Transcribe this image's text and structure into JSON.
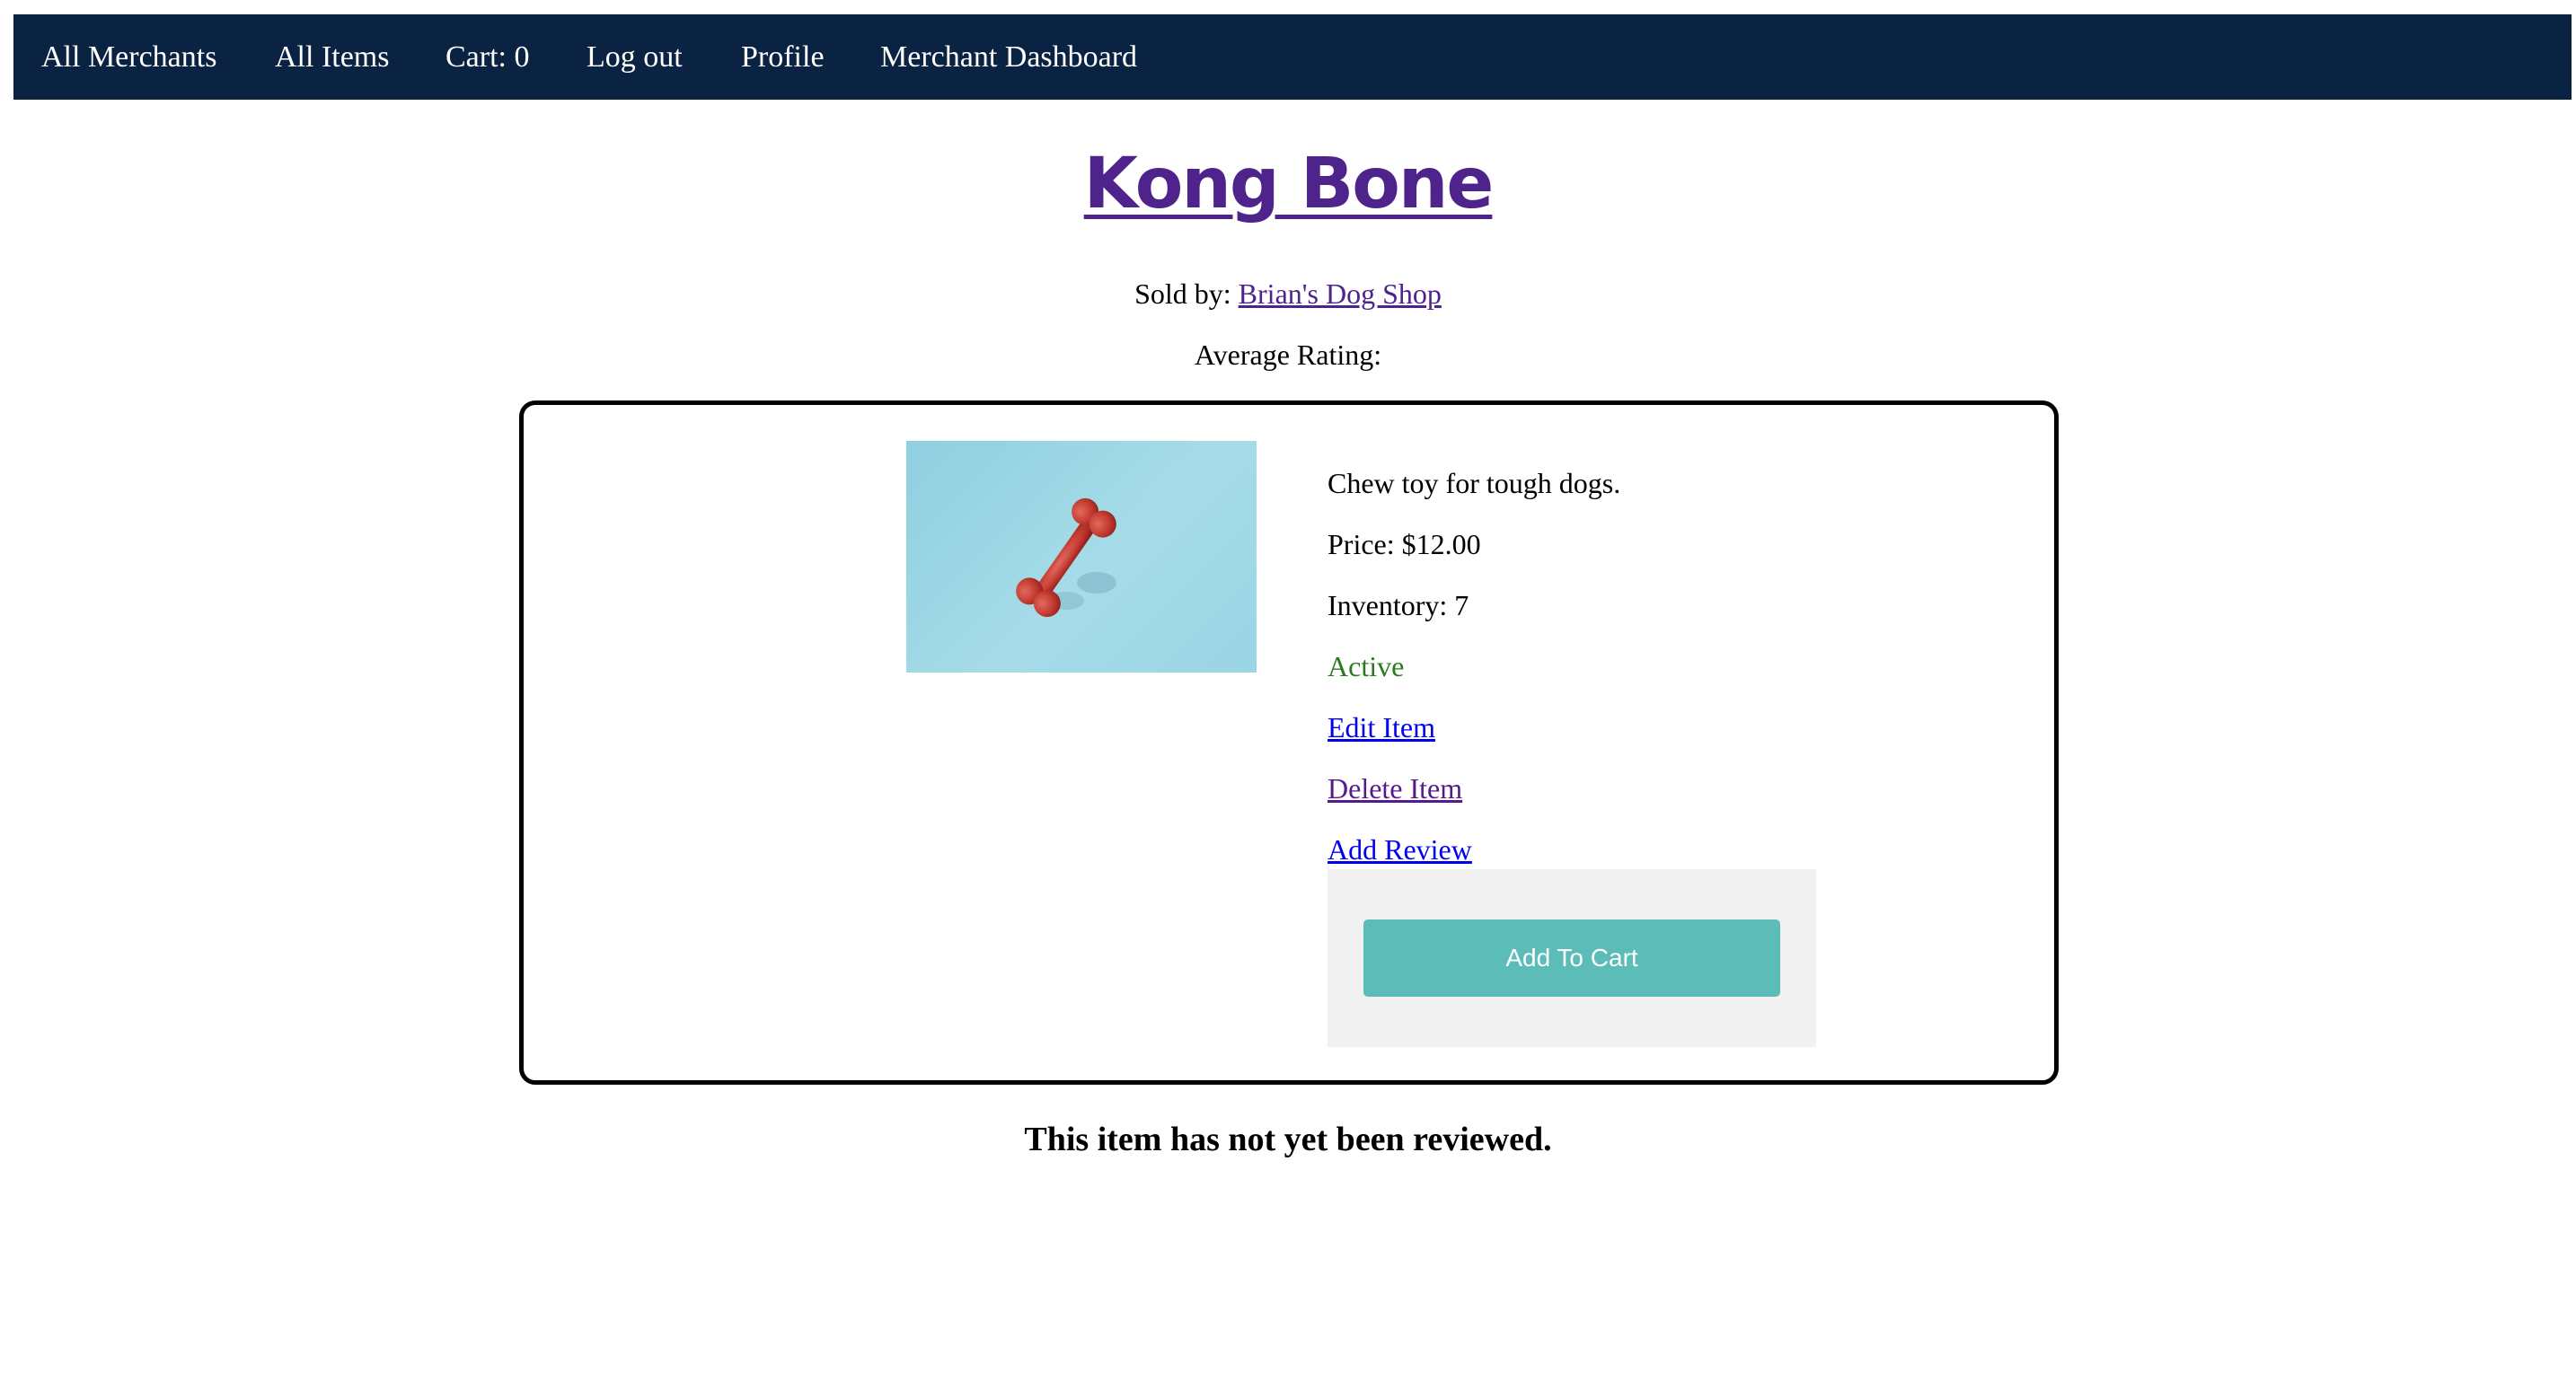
{
  "nav": {
    "items": [
      {
        "label": "All Merchants"
      },
      {
        "label": "All Items"
      },
      {
        "label": "Cart: 0"
      },
      {
        "label": "Log out"
      },
      {
        "label": "Profile"
      },
      {
        "label": "Merchant Dashboard"
      }
    ]
  },
  "item": {
    "name": "Kong Bone",
    "sold_by_label": "Sold by:",
    "merchant_name": "Brian's Dog Shop",
    "average_rating_label": "Average Rating:",
    "description": "Chew toy for tough dogs.",
    "price": "Price: $12.00",
    "inventory": "Inventory: 7",
    "status": "Active",
    "edit_label": "Edit Item",
    "delete_label": "Delete Item",
    "review_label": "Add Review",
    "add_to_cart_label": "Add To Cart"
  },
  "reviews": {
    "empty_message": "This item has not yet been reviewed."
  },
  "colors": {
    "nav_background": "#0a2342",
    "title": "#4f238c",
    "status_active": "#2c7a1f",
    "cart_button": "#5bbcb8"
  },
  "icons": {
    "item_image": "red-bone-chew-toy"
  }
}
